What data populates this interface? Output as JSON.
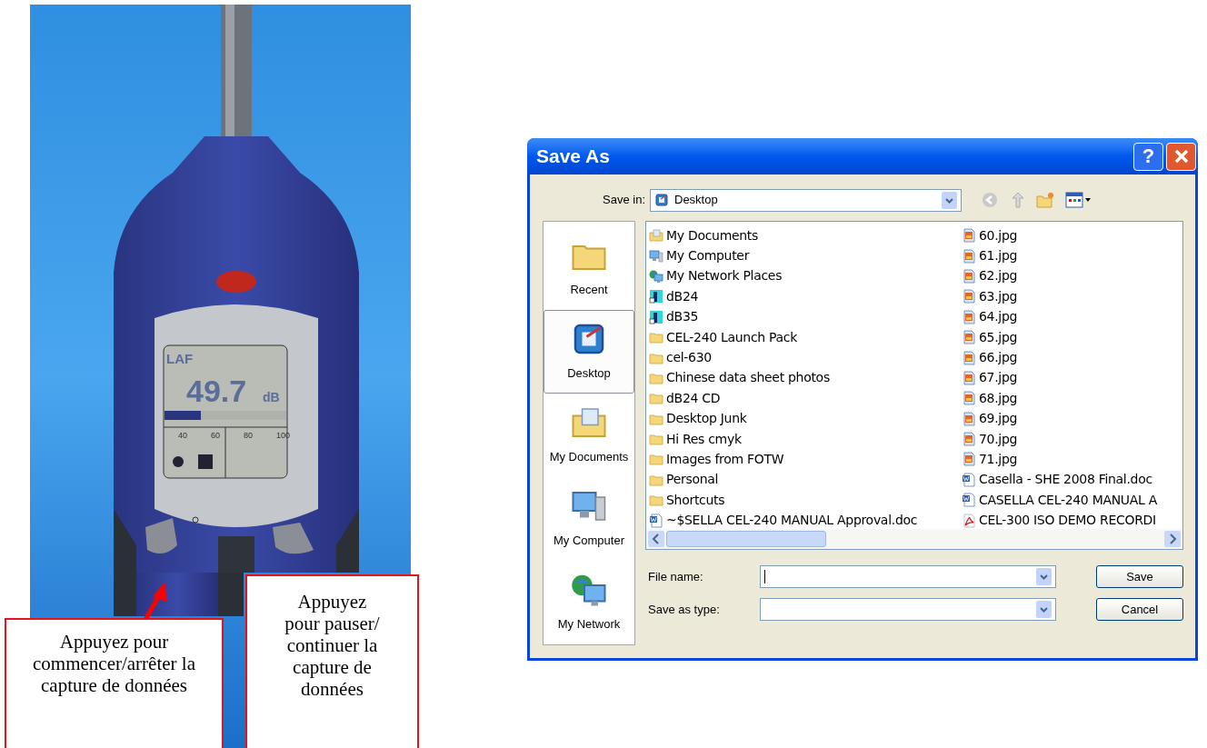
{
  "meter_display": {
    "mode": "LAF",
    "reading": "49.7",
    "unit": "dB",
    "scale": [
      "40",
      "60",
      "80",
      "100"
    ],
    "level": 0.3
  },
  "callouts": [
    {
      "text": "Appuyez pour commencer/arrêter la capture de données"
    },
    {
      "text": "Appuyez pour pauser/ continuer la capture de données"
    }
  ],
  "dialog": {
    "title": "Save As",
    "help_button": "?",
    "save_in": {
      "label": "Save in:",
      "value": "Desktop"
    },
    "places": [
      {
        "label": "Recent",
        "kind": "recent",
        "selected": false
      },
      {
        "label": "Desktop",
        "kind": "desktop",
        "selected": true
      },
      {
        "label": "My Documents",
        "kind": "documents",
        "selected": false
      },
      {
        "label": "My Computer",
        "kind": "computer",
        "selected": false
      },
      {
        "label": "My Network",
        "kind": "network",
        "selected": false
      }
    ],
    "files": [
      {
        "name": "My Documents",
        "kind": "documents"
      },
      {
        "name": "My Computer",
        "kind": "computer"
      },
      {
        "name": "My Network Places",
        "kind": "network"
      },
      {
        "name": "dB24",
        "kind": "app"
      },
      {
        "name": "dB35",
        "kind": "app"
      },
      {
        "name": "CEL-240 Launch Pack",
        "kind": "folder"
      },
      {
        "name": "cel-630",
        "kind": "folder"
      },
      {
        "name": "Chinese data sheet photos",
        "kind": "folder"
      },
      {
        "name": "dB24 CD",
        "kind": "folder"
      },
      {
        "name": "Desktop Junk",
        "kind": "folder"
      },
      {
        "name": "Hi Res cmyk",
        "kind": "folder"
      },
      {
        "name": "Images from FOTW",
        "kind": "folder"
      },
      {
        "name": "Personal",
        "kind": "folder"
      },
      {
        "name": "Shortcuts",
        "kind": "folder"
      },
      {
        "name": "~$SELLA CEL-240 MANUAL Approval.doc",
        "kind": "doc"
      },
      {
        "name": "60.jpg",
        "kind": "image"
      },
      {
        "name": "61.jpg",
        "kind": "image"
      },
      {
        "name": "62.jpg",
        "kind": "image"
      },
      {
        "name": "63.jpg",
        "kind": "image"
      },
      {
        "name": "64.jpg",
        "kind": "image"
      },
      {
        "name": "65.jpg",
        "kind": "image"
      },
      {
        "name": "66.jpg",
        "kind": "image"
      },
      {
        "name": "67.jpg",
        "kind": "image"
      },
      {
        "name": "68.jpg",
        "kind": "image"
      },
      {
        "name": "69.jpg",
        "kind": "image"
      },
      {
        "name": "70.jpg",
        "kind": "image"
      },
      {
        "name": "71.jpg",
        "kind": "image"
      },
      {
        "name": "Casella - SHE 2008 Final.doc",
        "kind": "doc"
      },
      {
        "name": "CASELLA CEL-240 MANUAL A",
        "kind": "doc"
      },
      {
        "name": "CEL-300 ISO DEMO RECORDI",
        "kind": "pdf"
      }
    ],
    "file_name": {
      "label": "File name:"
    },
    "save_as_type": {
      "label": "Save as type:"
    },
    "buttons": [
      "Save",
      "Cancel"
    ]
  }
}
